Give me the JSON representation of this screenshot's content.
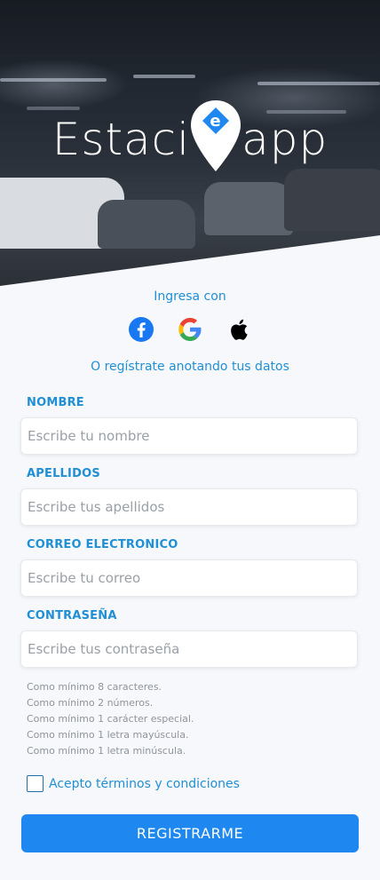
{
  "brand": {
    "name_left": "Estaci",
    "name_right": "app",
    "pin_letter": "e"
  },
  "social": {
    "title": "Ingresa con",
    "buttons": [
      {
        "name": "facebook-icon",
        "color": "#1877f2"
      },
      {
        "name": "google-icon",
        "color": "#4285f4"
      },
      {
        "name": "apple-icon",
        "color": "#000000"
      }
    ],
    "register_note": "O regístrate anotando tus datos"
  },
  "form": {
    "fields": [
      {
        "label": "NOMBRE",
        "placeholder": "Escribe tu nombre"
      },
      {
        "label": "APELLIDOS",
        "placeholder": "Escribe tus apellidos"
      },
      {
        "label": "CORREO ELECTRONICO",
        "placeholder": "Escribe tu correo"
      },
      {
        "label": "CONTRASEÑA",
        "placeholder": "Escribe tus contraseña"
      }
    ],
    "password_rules": [
      "Como mínimo 8 caracteres.",
      "Como mínimo 2 números.",
      "Como mínimo 1 carácter especial.",
      "Como mínimo 1 letra mayúscula.",
      "Como mínimo 1 letra minúscula."
    ],
    "terms_label": "Acepto términos y condiciones",
    "terms_checked": false,
    "submit_label": "REGISTRARME"
  },
  "colors": {
    "accent": "#1f8fd6",
    "button": "#1e88f0"
  }
}
